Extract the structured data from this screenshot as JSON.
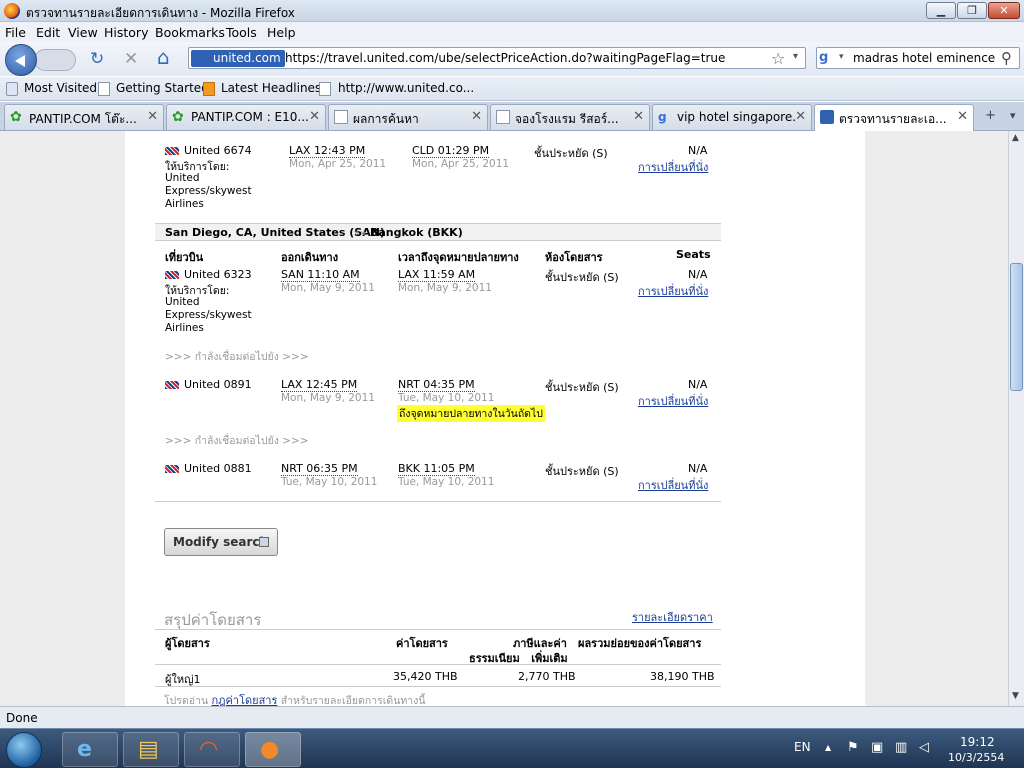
{
  "window": {
    "title": "ตรวจทานรายละเอียดการเดินทาง - Mozilla Firefox",
    "minimize": "▁",
    "maximize": "❐",
    "close": "✕"
  },
  "menu": [
    "File",
    "Edit",
    "View",
    "History",
    "Bookmarks",
    "Tools",
    "Help"
  ],
  "nav": {
    "site_badge": "united.com",
    "url": "https://travel.united.com/ube/selectPriceAction.do?waitingPageFlag=true",
    "search_value": "madras hotel eminence",
    "reload_glyph": "↻",
    "stop_glyph": "✕",
    "home_glyph": "⌂",
    "star_glyph": "☆",
    "search_glyph": "⚲"
  },
  "bookmarks": [
    "Most Visited",
    "Getting Started",
    "Latest Headlines",
    "http://www.united.co..."
  ],
  "tabs": [
    {
      "label": "PANTIP.COM โต๊ะ...",
      "close": "✕"
    },
    {
      "label": "PANTIP.COM : E10...",
      "close": "✕"
    },
    {
      "label": "ผลการค้นหา",
      "close": "✕"
    },
    {
      "label": "จองโรงแรม รีสอร์...",
      "close": "✕"
    },
    {
      "label": "vip hotel singapore...",
      "close": "✕"
    },
    {
      "label": "ตรวจทานรายละเอ...",
      "close": "✕"
    }
  ],
  "tabbar_extra": {
    "new_tab": "+",
    "list": "▾"
  },
  "flights_top": {
    "carrier": "United 6674",
    "operated_label": "ให้บริการโดย:",
    "operator_lines": [
      "United",
      "Express/skywest",
      "Airlines"
    ],
    "dep_time": "LAX 12:43 PM",
    "dep_date": "Mon, Apr 25, 2011",
    "arr_time": "CLD 01:29 PM",
    "arr_date": "Mon, Apr 25, 2011",
    "cabin": "ชั้นประหยัด (S)",
    "seats": "N/A",
    "seat_link": "การเปลี่ยนที่นั่ง"
  },
  "route": {
    "from": "San Diego, CA, United States (SAN)",
    "arrow": "»»",
    "to": "Bangkok (BKK)"
  },
  "columns": {
    "flight": "เที่ยวบิน",
    "depart": "ออกเดินทาง",
    "arrive": "เวลาถึงจุดหมายปลายทาง",
    "cabin": "ห้องโดยสาร",
    "seats": "Seats"
  },
  "segments": [
    {
      "carrier": "United 6323",
      "operated_label": "ให้บริการโดย:",
      "operator_lines": [
        "United",
        "Express/skywest",
        "Airlines"
      ],
      "dep_time": "SAN 11:10 AM",
      "dep_date": "Mon, May 9, 2011",
      "arr_time": "LAX 11:59 AM",
      "arr_date": "Mon, May 9, 2011",
      "cabin": "ชั้นประหยัด (S)",
      "seats": "N/A",
      "seat_link": "การเปลี่ยนที่นั่ง"
    },
    {
      "carrier": "United 0891",
      "dep_time": "LAX 12:45 PM",
      "dep_date": "Mon, May 9, 2011",
      "arr_time": "NRT 04:35 PM",
      "arr_date": "Tue, May 10, 2011",
      "next_day_note": "ถึงจุดหมายปลายทางในวันถัดไป",
      "cabin": "ชั้นประหยัด (S)",
      "seats": "N/A",
      "seat_link": "การเปลี่ยนที่นั่ง"
    },
    {
      "carrier": "United 0881",
      "dep_time": "NRT 06:35 PM",
      "dep_date": "Tue, May 10, 2011",
      "arr_time": "BKK 11:05 PM",
      "arr_date": "Tue, May 10, 2011",
      "cabin": "ชั้นประหยัด (S)",
      "seats": "N/A",
      "seat_link": "การเปลี่ยนที่นั่ง"
    }
  ],
  "connection_note": ">>> กำลังเชื่อมต่อไปยัง >>>",
  "modify_search": "Modify search",
  "fare": {
    "title": "สรุปค่าโดยสาร",
    "details_link": "รายละเอียดราคา",
    "col_passenger": "ผู้โดยสาร",
    "col_fare": "ค่าโดยสาร",
    "col_tax_line1": "ภาษีและค่า",
    "col_tax_line2": "ธรรมเนียม   เพิ่มเติม",
    "col_total": "ผลรวมย่อยของค่าโดยสาร",
    "row_passenger": "ผู้ใหญ่1",
    "row_fare": "35,420 THB",
    "row_tax": "2,770 THB",
    "row_total": "38,190 THB",
    "footnote_pre": "โปรดอ่าน",
    "footnote_link": "กฎค่าโดยสาร",
    "footnote_post": "สำหรับรายละเอียดการเดินทางนี้"
  },
  "status": "Done",
  "tray": {
    "lang": "EN",
    "time": "19:12",
    "date": "10/3/2554",
    "arrow": "▲"
  }
}
